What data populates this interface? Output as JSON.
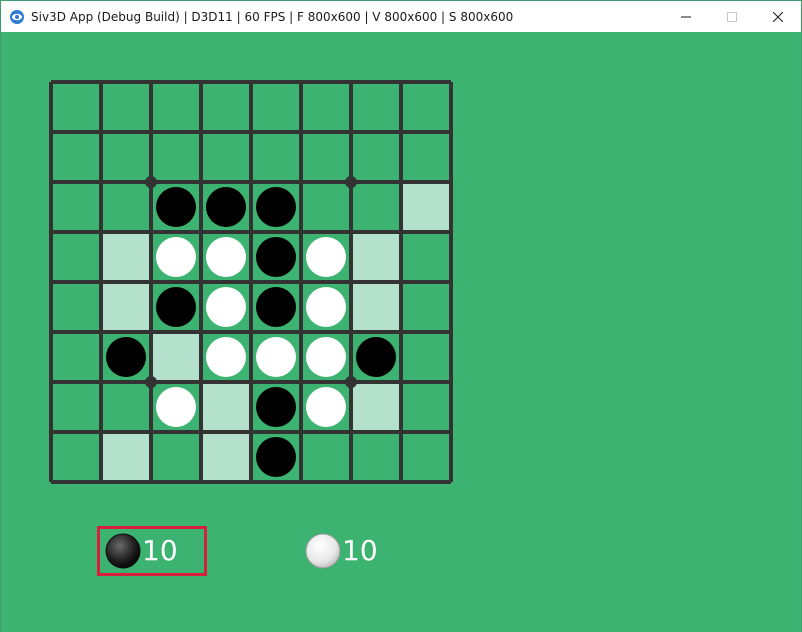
{
  "window": {
    "title": "Siv3D App (Debug Build) | D3D11 | 60 FPS | F 800x600 | V 800x600 | S 800x600",
    "app_icon": "siv3d-icon",
    "controls": [
      "minimize-icon",
      "maximize-icon",
      "close-icon"
    ]
  },
  "colors": {
    "background": "#3cb371",
    "grid_line": "#333333",
    "legal_move_highlight": "#b3e1cb",
    "black_stone": "#000000",
    "white_stone": "#ffffff",
    "turn_marker": "#d8203c"
  },
  "board": {
    "rows": 8,
    "cols": 8,
    "cells": [
      "........",
      "........",
      "..BBB..h",
      ".hWWBWh.",
      ".hBWBWh.",
      ".BhWWWB.",
      "..WhBWh.",
      ".h.hB..."
    ],
    "legend": {
      "B": "black",
      "W": "white",
      "h": "legal-move",
      ".": "empty"
    },
    "star_points": [
      [
        2,
        2
      ],
      [
        2,
        6
      ],
      [
        6,
        2
      ],
      [
        6,
        6
      ]
    ]
  },
  "scores": {
    "black": "10",
    "white": "10",
    "current_turn": "black"
  }
}
